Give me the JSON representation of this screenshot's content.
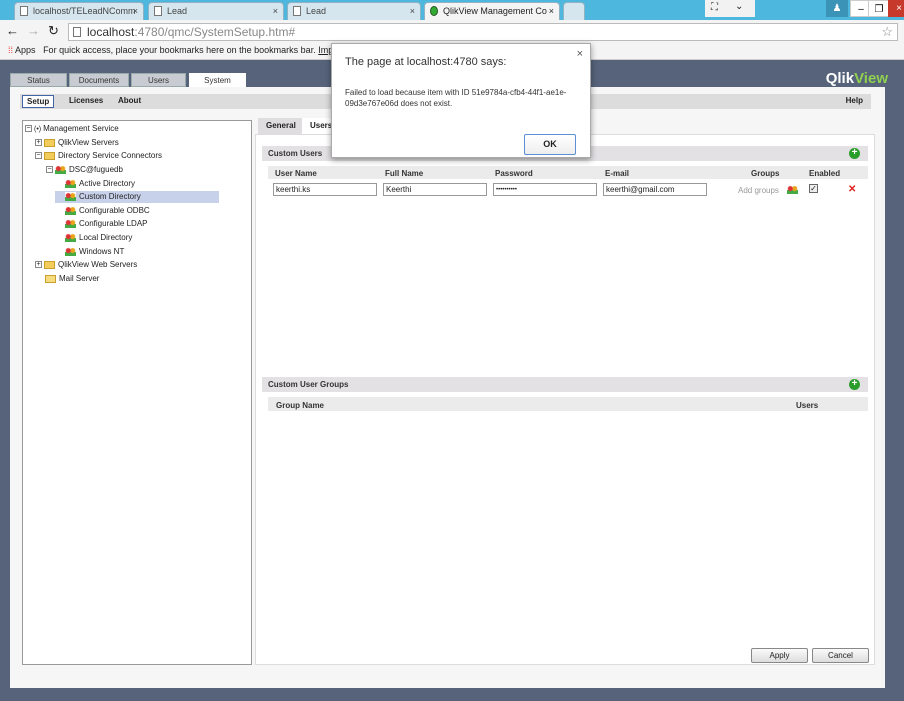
{
  "browser": {
    "tabs": [
      {
        "label": "localhost/TELeadNComm"
      },
      {
        "label": "Lead"
      },
      {
        "label": "Lead"
      },
      {
        "label": "QlikView Management Co"
      }
    ],
    "url_host": "localhost",
    "url_rest": ":4780/qmc/SystemSetup.htm#",
    "bookmarks": {
      "apps": "Apps",
      "hint": "For quick access, place your bookmarks here on the bookmarks bar.",
      "import": "Impor"
    }
  },
  "app": {
    "logo_a": "Qlik",
    "logo_b": "View",
    "nav_tabs": [
      "Status",
      "Documents",
      "Users",
      "System"
    ],
    "active_nav": "System",
    "subnav": [
      "Setup",
      "Licenses",
      "About"
    ],
    "help": "Help"
  },
  "tree": {
    "root": "Management Service",
    "items": [
      "QlikView Servers",
      "Directory Service Connectors",
      "DSC@fuguedb",
      "Active Directory",
      "Custom Directory",
      "Configurable ODBC",
      "Configurable LDAP",
      "Local Directory",
      "Windows NT",
      "QlikView Web Servers",
      "Mail Server"
    ],
    "selected": "Custom Directory"
  },
  "content": {
    "tabs": [
      "General",
      "Users"
    ],
    "custom_users": {
      "title": "Custom Users",
      "columns": [
        "User Name",
        "Full Name",
        "Password",
        "E-mail",
        "Groups",
        "Enabled"
      ],
      "row": {
        "user_name": "keerthi.ks",
        "full_name": "Keerthi",
        "password": "••••••••••",
        "email": "keerthi@gmail.com",
        "groups_link": "Add groups",
        "enabled": true
      }
    },
    "custom_groups": {
      "title": "Custom User Groups",
      "columns": [
        "Group Name",
        "Users"
      ]
    },
    "apply": "Apply",
    "cancel": "Cancel"
  },
  "dialog": {
    "title": "The page at localhost:4780 says:",
    "message": "Failed to load because item with ID 51e9784a-cfb4-44f1-ae1e-09d3e767e06d does not exist.",
    "ok": "OK",
    "close": "×"
  }
}
